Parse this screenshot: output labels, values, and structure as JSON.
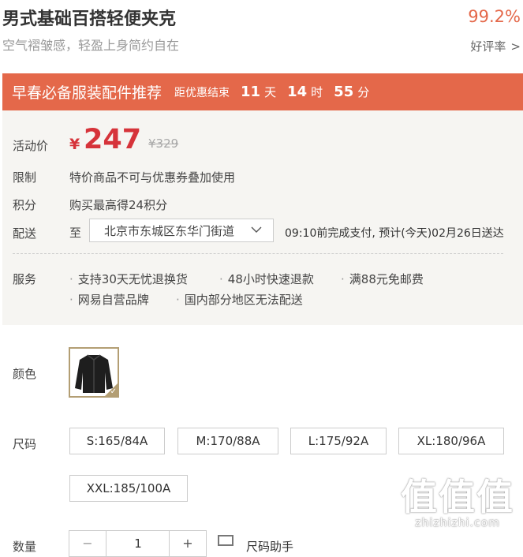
{
  "product": {
    "title": "男式基础百搭轻便夹克",
    "subtitle": "空气褶皱感，轻盈上身简约自在",
    "rating_value": "99.2%",
    "rating_label": "好评率",
    "rating_chevron": ">"
  },
  "promo": {
    "title": "早春必备服装配件推荐",
    "countdown_label": "距优惠结束",
    "days": "11",
    "days_unit": "天",
    "hours": "14",
    "hours_unit": "时",
    "minutes": "55",
    "minutes_unit": "分",
    "bar_color": "#e4684a"
  },
  "pricing": {
    "label": "活动价",
    "currency": "¥",
    "current": "247",
    "original": "¥329",
    "price_color": "#d6333a"
  },
  "limit": {
    "label": "限制",
    "text": "特价商品不可与优惠券叠加使用"
  },
  "points": {
    "label": "积分",
    "text": "购买最高得24积分"
  },
  "delivery": {
    "label": "配送",
    "to": "至",
    "address": "北京市东城区东华门街道",
    "note": "09:10前完成支付, 预计(今天)02月26日送达"
  },
  "service": {
    "label": "服务",
    "items": [
      "支持30天无忧退换货",
      "48小时快速退款",
      "满88元免邮费",
      "网易自营品牌",
      "国内部分地区无法配送"
    ],
    "bullet": "·"
  },
  "color": {
    "label": "颜色",
    "swatch": "black-jacket-thumbnail",
    "accent": "#b39e73"
  },
  "size": {
    "label": "尺码",
    "options": [
      "S:165/84A",
      "M:170/88A",
      "L:175/92A",
      "XL:180/96A",
      "XXL:185/100A"
    ]
  },
  "quantity": {
    "label": "数量",
    "value": "1",
    "minus": "−",
    "plus": "+",
    "helper": "尺码助手",
    "helper_icon": "ruler-icon"
  },
  "watermark": {
    "logo": "值值值",
    "url": "zhizhizhi.com"
  }
}
